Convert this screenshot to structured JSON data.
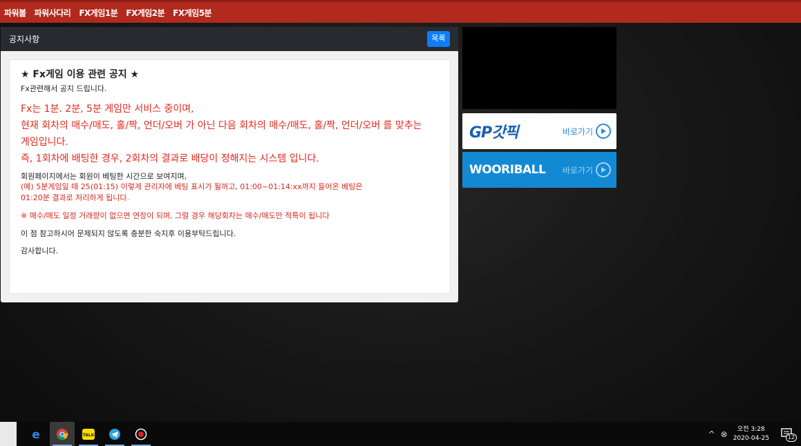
{
  "nav": {
    "items": [
      "파워볼",
      "파워사다리",
      "FX게임1분",
      "FX게임2분",
      "FX게임5분"
    ]
  },
  "panel": {
    "title": "공지사항",
    "list_button": "목록"
  },
  "notice": {
    "heading": "★ Fx게임 이용 관련 공지 ★",
    "intro": "Fx관련해서 공지 드립니다.",
    "red_lines": [
      "Fx는 1분. 2분, 5분 게임만 서비스 중이며,",
      "현재 회차의 매수/매도, 홀/짝, 언더/오버 가 아닌 다음 회차의 매수/매도, 홀/짝, 언더/오버 를 맞추는",
      "게임입니다.",
      "즉, 1회차에 배팅한 경우, 2회차의 결과로 배당이 정해지는 시스템 입니다."
    ],
    "member_line": "회원페이지에서는 회원이 베팅한 시간으로 보여지며,",
    "example_lines": [
      "(예) 5분게임일 때 25(01:15) 이렇게 관리자에 베팅 표시가 될꺼고, 01:00~01:14:xx까지 들어온 베팅은",
      "01:20분 결과로 처리하게 됩니다."
    ],
    "warning": "※ 매수/매도 일정 거래량이 없으면 연장이 되며, 그럴 경우 해당회차는 매수/매도만 적특이 됩니다",
    "closing": "이 점 참고하시어 문제되지 않도록 충분한 숙지후 이용부탁드립니다.",
    "thanks": "감사합니다."
  },
  "banners": {
    "gp": {
      "logo": "GP갓픽",
      "go": "바로가기"
    },
    "woori": {
      "logo": "WOORIBALL",
      "go": "바로가기"
    }
  },
  "taskbar": {
    "apps": [
      "edge-icon",
      "chrome-icon",
      "kakaotalk-icon",
      "telegram-icon",
      "record-icon"
    ],
    "time": "오전 3:28",
    "date": "2020-04-25",
    "notifications": "12"
  },
  "colors": {
    "topbar": "#b22a1e",
    "accent_red": "#e0281c",
    "button_blue": "#0d7ef8",
    "woori_blue": "#1389d3"
  }
}
